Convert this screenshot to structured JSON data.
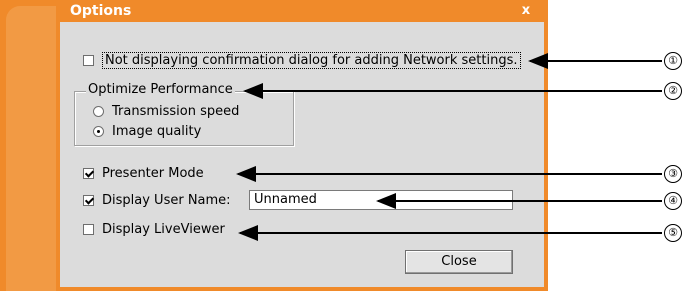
{
  "window": {
    "title": "Options",
    "close_glyph": "x"
  },
  "options": {
    "confirm_dialog_label": "Not displaying confirmation dialog for adding Network settings.",
    "performance_legend": "Optimize Performance",
    "radio_transmission": "Transmission speed",
    "radio_image_quality": "Image quality",
    "presenter_mode_label": "Presenter Mode",
    "display_user_name_label": "Display User Name:",
    "user_name_value": "Unnamed",
    "live_viewer_label": "Display LiveViewer",
    "close_button": "Close"
  },
  "state": {
    "confirm_dialog_checked": false,
    "selected_performance": "Image quality",
    "presenter_mode_checked": true,
    "display_user_name_checked": true,
    "live_viewer_checked": false
  },
  "callouts": [
    "①",
    "②",
    "③",
    "④",
    "⑤"
  ],
  "colors": {
    "accent": "#f08a2a",
    "panel": "#dcdcdc"
  }
}
